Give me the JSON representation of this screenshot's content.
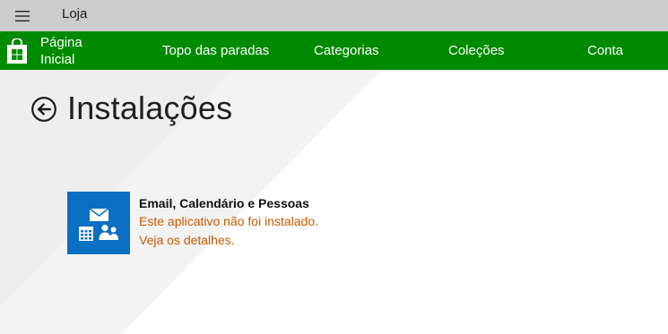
{
  "window": {
    "title": "Loja",
    "menu_icon": "hamburger-icon"
  },
  "nav": {
    "store_icon": "store-bag-icon",
    "home_label": "Página Inicial",
    "items": [
      {
        "label": "Topo das paradas"
      },
      {
        "label": "Categorias"
      },
      {
        "label": "Coleções"
      },
      {
        "label": "Conta"
      }
    ]
  },
  "page": {
    "back_icon": "back-arrow-icon",
    "title": "Instalações"
  },
  "installs": [
    {
      "icon": "mail-calendar-people-icon",
      "name": "Email, Calendário e Pessoas",
      "status": "Este aplicativo não foi instalado.",
      "details_link": "Veja os detalhes."
    }
  ],
  "colors": {
    "titlebar": "#cccccc",
    "nav_bg": "#008a00",
    "tile_bg": "#0a6fc2",
    "status_text": "#c55a00"
  }
}
